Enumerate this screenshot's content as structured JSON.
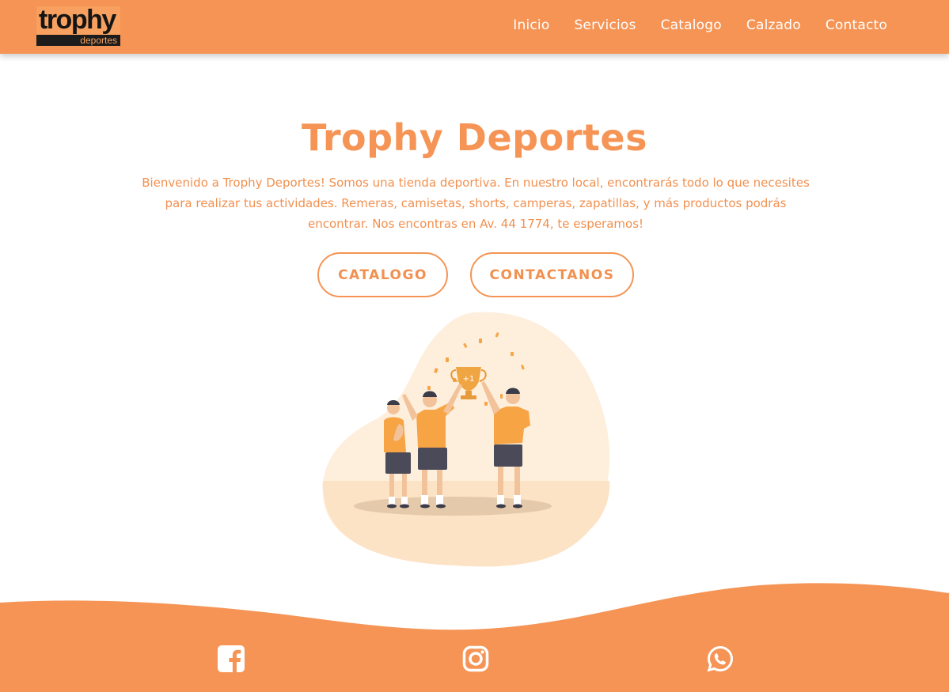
{
  "header": {
    "logo": {
      "word": "trophy",
      "sub": "deportes"
    },
    "nav": [
      {
        "label": "Inicio"
      },
      {
        "label": "Servicios"
      },
      {
        "label": "Catalogo"
      },
      {
        "label": "Calzado"
      },
      {
        "label": "Contacto"
      }
    ]
  },
  "hero": {
    "title": "Trophy Deportes",
    "description": "Bienvenido a Trophy Deportes! Somos una tienda deportiva. En nuestro local, encontrarás todo lo que necesites para realizar tus actividades. Remeras, camisetas, shorts, camperas, zapatillas, y más productos podrás encontrar. Nos encontras en Av. 44 1774, te esperamos!",
    "buttons": {
      "catalogo": "CATALOGO",
      "contact": "CONTACTANOS"
    },
    "illustration": {
      "icon": "team-trophy-celebration-illustration",
      "trophy_mark": "+1"
    }
  },
  "footer": {
    "social": [
      {
        "icon": "facebook-icon"
      },
      {
        "icon": "instagram-icon"
      },
      {
        "icon": "whatsapp-icon"
      }
    ]
  },
  "colors": {
    "accent": "#f59455",
    "text_accent": "#f2904f",
    "blob": "#feefdc",
    "shirt": "#f7a445",
    "shorts": "#4a4a58"
  }
}
